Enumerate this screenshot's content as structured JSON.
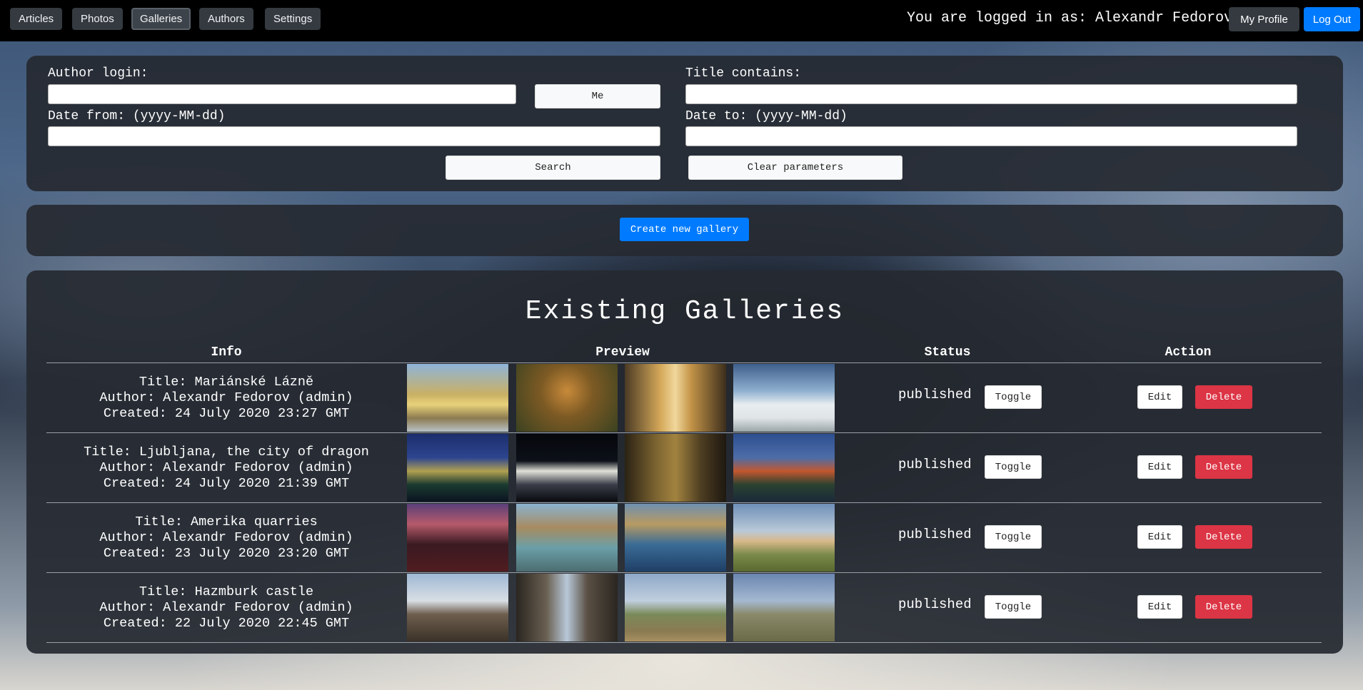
{
  "nav": {
    "items": [
      {
        "label": "Articles"
      },
      {
        "label": "Photos"
      },
      {
        "label": "Galleries"
      },
      {
        "label": "Authors"
      },
      {
        "label": "Settings"
      }
    ],
    "active": "Galleries",
    "login_text": "You are logged in as: Alexandr Fedorov",
    "profile_label": "My Profile",
    "logout_label": "Log Out"
  },
  "search": {
    "author_login_label": "Author login:",
    "author_login_value": "",
    "me_label": "Me",
    "title_contains_label": "Title contains:",
    "title_contains_value": "",
    "date_from_label": "Date from: (yyyy-MM-dd)",
    "date_from_value": "",
    "date_to_label": "Date to: (yyyy-MM-dd)",
    "date_to_value": "",
    "search_label": "Search",
    "clear_label": "Clear parameters"
  },
  "create": {
    "label": "Create new gallery"
  },
  "galleries": {
    "heading": "Existing Galleries",
    "columns": {
      "info": "Info",
      "preview": "Preview",
      "status": "Status",
      "action": "Action"
    },
    "toggle_label": "Toggle",
    "edit_label": "Edit",
    "delete_label": "Delete",
    "rows": [
      {
        "title": "Title: Mariánské Lázně",
        "author": "Author: Alexandr Fedorov (admin)",
        "created": "Created: 24 July 2020 23:27 GMT",
        "status": "published"
      },
      {
        "title": "Title: Ljubljana, the city of dragon",
        "author": "Author: Alexandr Fedorov (admin)",
        "created": "Created: 24 July 2020 21:39 GMT",
        "status": "published"
      },
      {
        "title": "Title: Amerika quarries",
        "author": "Author: Alexandr Fedorov (admin)",
        "created": "Created: 23 July 2020 23:20 GMT",
        "status": "published"
      },
      {
        "title": "Title: Hazmburk castle",
        "author": "Author: Alexandr Fedorov (admin)",
        "created": "Created: 22 July 2020 22:45 GMT",
        "status": "published"
      }
    ]
  }
}
